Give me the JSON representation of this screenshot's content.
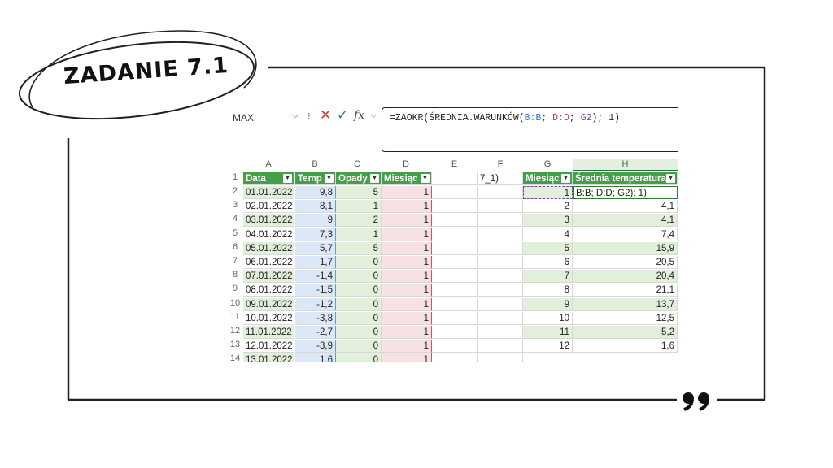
{
  "badge": {
    "title": "ZADANIE 7.1"
  },
  "excel": {
    "name_box": "MAX",
    "formula": {
      "prefix": "=ZAOKR(ŚREDNIA.WARUNKÓW(",
      "ref1": "B:B",
      "sep1": "; ",
      "ref2": "D:D",
      "sep2": "; ",
      "ref3": "G2",
      "suffix": "); 1)"
    },
    "column_letters": [
      "A",
      "B",
      "C",
      "D",
      "E",
      "F",
      "G",
      "H"
    ],
    "headers": {
      "data": "Data",
      "temp": "Temp",
      "opady": "Opady",
      "miesiac": "Miesiąc",
      "miesiac2": "Miesiąc",
      "srednia": "Średnia temperatura"
    },
    "f1_text": "7_1)",
    "row_numbers": [
      "1",
      "2",
      "3",
      "4",
      "5",
      "6",
      "7",
      "8",
      "9",
      "10",
      "11",
      "12",
      "13",
      "14"
    ],
    "rows": [
      {
        "date": "01.01.2022",
        "temp": "9,8",
        "opady": "5",
        "mies": "1",
        "g": "1",
        "h": "B:B; D:D; G2); 1)"
      },
      {
        "date": "02.01.2022",
        "temp": "8,1",
        "opady": "1",
        "mies": "1",
        "g": "2",
        "h": "4,1"
      },
      {
        "date": "03.01.2022",
        "temp": "9",
        "opady": "2",
        "mies": "1",
        "g": "3",
        "h": "4,1"
      },
      {
        "date": "04.01.2022",
        "temp": "7,3",
        "opady": "1",
        "mies": "1",
        "g": "4",
        "h": "7,4"
      },
      {
        "date": "05.01.2022",
        "temp": "5,7",
        "opady": "5",
        "mies": "1",
        "g": "5",
        "h": "15,9"
      },
      {
        "date": "06.01.2022",
        "temp": "1,7",
        "opady": "0",
        "mies": "1",
        "g": "6",
        "h": "20,5"
      },
      {
        "date": "07.01.2022",
        "temp": "-1,4",
        "opady": "0",
        "mies": "1",
        "g": "7",
        "h": "20,4"
      },
      {
        "date": "08.01.2022",
        "temp": "-1,5",
        "opady": "0",
        "mies": "1",
        "g": "8",
        "h": "21,1"
      },
      {
        "date": "09.01.2022",
        "temp": "-1,2",
        "opady": "0",
        "mies": "1",
        "g": "9",
        "h": "13,7"
      },
      {
        "date": "10.01.2022",
        "temp": "-3,8",
        "opady": "0",
        "mies": "1",
        "g": "10",
        "h": "12,5"
      },
      {
        "date": "11.01.2022",
        "temp": "-2,7",
        "opady": "0",
        "mies": "1",
        "g": "11",
        "h": "5,2"
      },
      {
        "date": "12.01.2022",
        "temp": "-3,9",
        "opady": "0",
        "mies": "1",
        "g": "12",
        "h": "1,6"
      },
      {
        "date": "13.01.2022",
        "temp": "1,6",
        "opady": "0",
        "mies": "1",
        "g": "",
        "h": ""
      }
    ]
  },
  "icons": {
    "quote": "quote-marks-icon",
    "cancel": "cancel-icon",
    "enter": "check-icon",
    "fx": "function-icon"
  }
}
